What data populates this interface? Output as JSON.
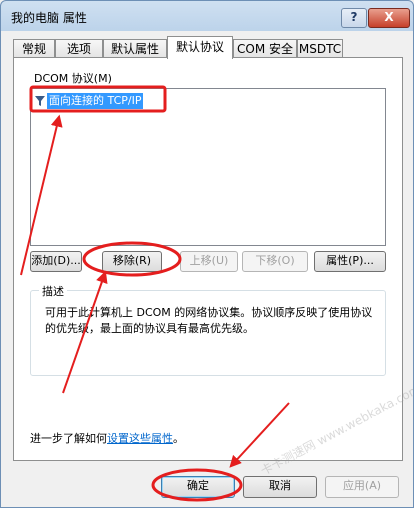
{
  "window": {
    "title": "我的电脑 属性",
    "help_label": "?",
    "close_label": "X"
  },
  "tabs": [
    {
      "label": "常规"
    },
    {
      "label": "选项"
    },
    {
      "label": "默认属性"
    },
    {
      "label": "默认协议"
    },
    {
      "label": "COM 安全"
    },
    {
      "label": "MSDTC"
    }
  ],
  "active_tab": "默认协议",
  "dcom": {
    "label": "DCOM 协议(M)",
    "items": [
      {
        "label": "面向连接的 TCP/IP",
        "icon": "filter-icon",
        "selected": true
      }
    ]
  },
  "actions": {
    "add": "添加(D)...",
    "remove": "移除(R)",
    "move_up": "上移(U)",
    "move_down": "下移(O)",
    "properties": "属性(P)..."
  },
  "description": {
    "legend": "描述",
    "text": "可用于此计算机上 DCOM 的网络协议集。协议顺序反映了使用协议的优先级，最上面的协议具有最高优先级。"
  },
  "learn_more": {
    "prefix": "进一步了解如何",
    "link": "设置这些属性",
    "suffix": "。"
  },
  "footer": {
    "ok": "确定",
    "cancel": "取消",
    "apply": "应用(A)"
  },
  "watermark": "卡卡测速网 www.webkaka.com",
  "colors": {
    "selection": "#3399ff",
    "annotation": "#e41e1e"
  }
}
